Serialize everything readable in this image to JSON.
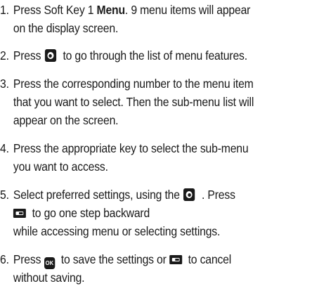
{
  "steps": [
    {
      "number": "1.",
      "line1_pre": "Press Soft Key 1 ",
      "line1_bold": "Menu",
      "line1_post": ". 9 menu items will appear",
      "line2": "on the display screen."
    },
    {
      "number": "2.",
      "line1_pre": "Press",
      "line1_post": "to go through the list of menu features.",
      "icon": "navigation-key-icon"
    },
    {
      "number": "3.",
      "line1": "Press the corresponding number to the menu item",
      "line2": "that you want to select. Then the sub-menu list will",
      "line3": "appear on the screen."
    },
    {
      "number": "4.",
      "line1": "Press the appropriate key to select the sub-menu",
      "line2": "you want to access."
    },
    {
      "number": "5.",
      "line1_pre": "Select preferred settings, using the",
      "line1_post": ". Press",
      "line2": "to go one step backward",
      "line3": "while accessing menu or selecting settings.",
      "icons": [
        "navigation-key-icon",
        "soft-key-icon"
      ]
    },
    {
      "number": "6.",
      "line1_pre": "Press",
      "ok_label": "OK",
      "line1_mid": "to save the settings or",
      "line1_post": "to cancel",
      "line2": "without saving.",
      "icons": [
        "ok-key-icon",
        "soft-key-icon"
      ]
    }
  ]
}
